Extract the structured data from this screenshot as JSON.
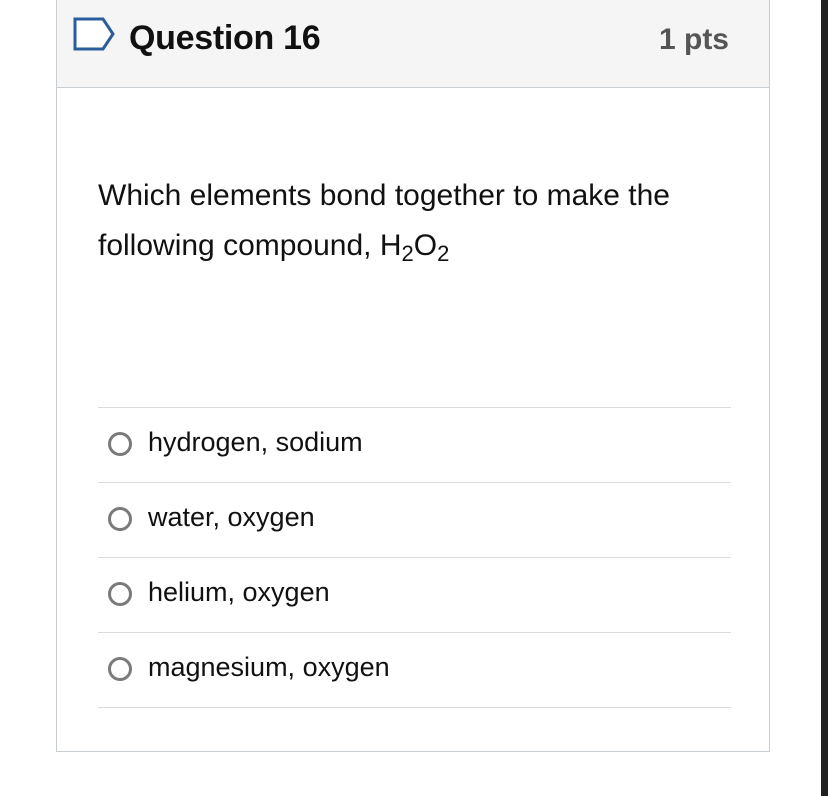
{
  "question": {
    "title": "Question 16",
    "points": "1 pts",
    "flag_icon": "flag-outline-icon",
    "text_prefix": "Which elements bond together to make the following compound, H",
    "sub_1": "2",
    "text_mid": "O",
    "sub_2": "2"
  },
  "answers": [
    {
      "label": "hydrogen, sodium",
      "selected": false
    },
    {
      "label": "water, oxygen",
      "selected": false
    },
    {
      "label": "helium, oxygen",
      "selected": false
    },
    {
      "label": "magnesium, oxygen",
      "selected": false
    }
  ],
  "colors": {
    "header_bg": "#f5f5f5",
    "border": "#c7cdd1",
    "radio": "#7a7a7a",
    "text": "#111111",
    "points": "#555555"
  }
}
